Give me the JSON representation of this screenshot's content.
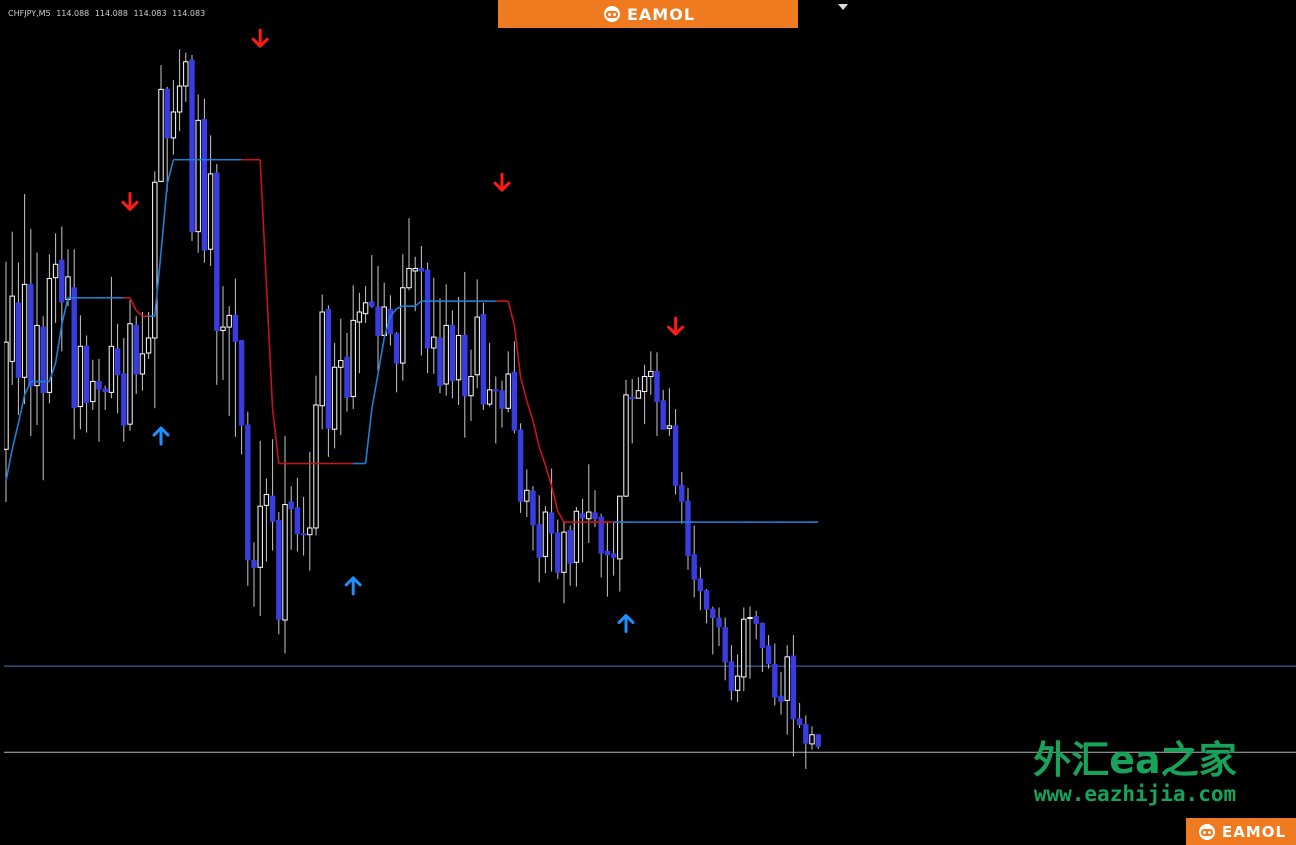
{
  "chart_header": {
    "symbol": "CHFJPY,M5",
    "ohlc": [
      "114.088",
      "114.088",
      "114.083",
      "114.083"
    ]
  },
  "branding": {
    "top_banner_text": "EAMOL",
    "bottom_banner_text": "EAMOL",
    "watermark_title": "外汇ea之家",
    "watermark_url": "www.eazhijia.com"
  },
  "colors": {
    "background": "#000000",
    "bull_candle": "#ffffff",
    "bear_candle": "#3a3ce0",
    "wick": "#c8c8c8",
    "trail_up": "#1e7fd6",
    "trail_down": "#c8141e",
    "arrow_up": "#1e90ff",
    "arrow_down": "#ff1a1a",
    "level_blue": "#3a78c8",
    "level_gray": "#b4b4b4",
    "banner": "#f07a1f",
    "watermark": "#17a35a"
  },
  "chart_data": {
    "type": "candlestick",
    "ylim": [
      0,
      100
    ],
    "horizontal_levels": [
      {
        "value": 20.9,
        "color": "level_blue"
      },
      {
        "value": 10.6,
        "color": "level_gray"
      }
    ],
    "candles": [
      [
        46.8,
        59.6,
        69.2,
        40.5
      ],
      [
        57.3,
        65.1,
        72.8,
        54.5
      ],
      [
        64.3,
        55.4,
        69.1,
        50.9
      ],
      [
        55.4,
        66.5,
        77.3,
        52.2
      ],
      [
        66.5,
        54.4,
        73.1,
        48.4
      ],
      [
        54.4,
        61.6,
        70.3,
        49.7
      ],
      [
        61.4,
        53.6,
        62.7,
        43.1
      ],
      [
        53.6,
        67.2,
        70.1,
        52.3
      ],
      [
        67.3,
        68.9,
        72.6,
        61.9
      ],
      [
        69.4,
        64.4,
        73.4,
        58.5
      ],
      [
        64.7,
        67.4,
        70.7,
        63.9
      ],
      [
        66.1,
        51.8,
        70.7,
        48.0
      ],
      [
        51.9,
        59.1,
        62.8,
        49.2
      ],
      [
        59.1,
        52.4,
        60.4,
        48.8
      ],
      [
        52.5,
        54.9,
        57.5,
        51.5
      ],
      [
        54.9,
        54.0,
        57.6,
        47.7
      ],
      [
        54.0,
        53.7,
        54.4,
        51.5
      ],
      [
        53.6,
        59.1,
        67.4,
        52.9
      ],
      [
        58.8,
        55.7,
        61.8,
        51.1
      ],
      [
        55.8,
        49.7,
        60.1,
        47.7
      ],
      [
        49.8,
        61.8,
        64.6,
        49.0
      ],
      [
        61.6,
        55.8,
        62.7,
        53.4
      ],
      [
        55.8,
        58.2,
        63.2,
        53.8
      ],
      [
        58.3,
        60.1,
        63.2,
        57.6
      ],
      [
        60.1,
        78.7,
        80.0,
        51.7
      ],
      [
        78.8,
        89.8,
        92.7,
        78.7
      ],
      [
        89.8,
        84.0,
        90.1,
        77.6
      ],
      [
        84.0,
        87.1,
        90.9,
        82.0
      ],
      [
        87.1,
        90.2,
        94.6,
        84.8
      ],
      [
        90.2,
        93.1,
        94.2,
        88.3
      ],
      [
        93.3,
        72.8,
        93.9,
        71.7
      ],
      [
        72.8,
        86.1,
        89.2,
        70.3
      ],
      [
        86.2,
        70.6,
        88.7,
        69.1
      ],
      [
        70.7,
        79.7,
        84.3,
        68.7
      ],
      [
        79.8,
        61.0,
        80.9,
        54.5
      ],
      [
        61.0,
        61.4,
        66.3,
        55.1
      ],
      [
        61.4,
        62.8,
        63.9,
        50.8
      ],
      [
        62.8,
        59.7,
        67.2,
        48.3
      ],
      [
        59.8,
        49.7,
        59.6,
        46.2
      ],
      [
        49.7,
        33.6,
        51.3,
        30.5
      ],
      [
        33.5,
        32.7,
        35.7,
        28.0
      ],
      [
        32.7,
        40.0,
        47.8,
        26.9
      ],
      [
        40.1,
        41.4,
        43.3,
        33.4
      ],
      [
        41.2,
        38.2,
        48.0,
        34.7
      ],
      [
        38.3,
        26.5,
        39.3,
        24.7
      ],
      [
        26.4,
        40.2,
        48.4,
        22.4
      ],
      [
        40.5,
        39.7,
        42.4,
        34.8
      ],
      [
        39.8,
        36.7,
        43.4,
        34.6
      ],
      [
        36.7,
        36.6,
        41.1,
        34.1
      ],
      [
        36.6,
        37.4,
        46.5,
        32.3
      ],
      [
        37.4,
        52.1,
        55.6,
        36.5
      ],
      [
        52.0,
        63.2,
        65.3,
        49.2
      ],
      [
        63.5,
        49.3,
        64.0,
        45.9
      ],
      [
        49.2,
        56.6,
        59.5,
        46.9
      ],
      [
        56.6,
        57.4,
        62.4,
        48.5
      ],
      [
        57.8,
        53.0,
        60.7,
        51.3
      ],
      [
        53.1,
        62.2,
        66.4,
        51.6
      ],
      [
        62.0,
        63.2,
        65.5,
        55.9
      ],
      [
        63.0,
        64.3,
        66.3,
        61.9
      ],
      [
        64.4,
        63.9,
        70.0,
        63.7
      ],
      [
        63.8,
        60.4,
        68.7,
        56.1
      ],
      [
        60.4,
        63.8,
        66.7,
        60.5
      ],
      [
        63.5,
        60.6,
        65.2,
        59.2
      ],
      [
        60.6,
        57.1,
        60.8,
        53.6
      ],
      [
        57.1,
        66.1,
        70.1,
        55.0
      ],
      [
        66.1,
        68.4,
        74.4,
        65.8
      ],
      [
        68.1,
        68.4,
        69.8,
        63.3
      ],
      [
        68.4,
        68.1,
        71.1,
        58.0
      ],
      [
        68.2,
        58.9,
        69.1,
        55.9
      ],
      [
        58.9,
        60.2,
        67.3,
        55.8
      ],
      [
        60.1,
        54.4,
        64.8,
        53.5
      ],
      [
        54.6,
        61.6,
        66.5,
        53.2
      ],
      [
        61.6,
        55.0,
        63.4,
        52.9
      ],
      [
        55.1,
        60.4,
        65.0,
        52.1
      ],
      [
        60.4,
        53.2,
        68.0,
        48.2
      ],
      [
        53.2,
        55.5,
        58.7,
        50.2
      ],
      [
        55.7,
        62.6,
        67.1,
        54.1
      ],
      [
        62.9,
        52.2,
        64.3,
        51.5
      ],
      [
        52.2,
        53.9,
        59.5,
        51.9
      ],
      [
        53.9,
        53.8,
        55.5,
        47.5
      ],
      [
        53.8,
        51.7,
        55.0,
        49.4
      ],
      [
        51.7,
        55.8,
        58.5,
        51.2
      ],
      [
        56.0,
        49.1,
        59.7,
        48.7
      ],
      [
        49.1,
        40.6,
        49.9,
        39.2
      ],
      [
        40.6,
        41.9,
        44.4,
        38.7
      ],
      [
        41.8,
        37.8,
        42.4,
        34.7
      ],
      [
        37.8,
        33.9,
        41.3,
        30.9
      ],
      [
        34.0,
        39.3,
        40.0,
        32.0
      ],
      [
        39.2,
        36.8,
        44.5,
        32.2
      ],
      [
        36.8,
        32.1,
        38.4,
        31.3
      ],
      [
        32.1,
        36.9,
        38.2,
        28.4
      ],
      [
        37.1,
        33.2,
        37.7,
        30.5
      ],
      [
        33.3,
        39.4,
        39.9,
        30.4
      ],
      [
        39.1,
        38.6,
        40.9,
        33.3
      ],
      [
        38.5,
        39.3,
        45.0,
        35.6
      ],
      [
        39.2,
        38.5,
        41.9,
        37.5
      ],
      [
        38.7,
        34.4,
        39.1,
        31.5
      ],
      [
        34.6,
        34.2,
        38.2,
        29.2
      ],
      [
        34.3,
        33.9,
        38.1,
        31.7
      ],
      [
        33.7,
        41.2,
        41.0,
        29.8
      ],
      [
        41.2,
        53.3,
        55.1,
        41.1
      ],
      [
        53.0,
        52.9,
        55.2,
        47.5
      ],
      [
        52.9,
        53.8,
        55.4,
        53.1
      ],
      [
        53.7,
        55.5,
        56.9,
        49.8
      ],
      [
        55.5,
        56.1,
        58.5,
        53.3
      ],
      [
        56.1,
        52.5,
        58.4,
        48.4
      ],
      [
        52.6,
        49.2,
        53.9,
        49.4
      ],
      [
        49.3,
        49.6,
        54.1,
        48.4
      ],
      [
        49.6,
        42.5,
        51.6,
        41.4
      ],
      [
        42.5,
        40.6,
        44.1,
        37.9
      ],
      [
        40.6,
        34.1,
        42.2,
        32.4
      ],
      [
        34.2,
        31.3,
        37.7,
        29.1
      ],
      [
        31.3,
        29.9,
        32.7,
        27.6
      ],
      [
        29.9,
        27.7,
        30.1,
        26.0
      ],
      [
        27.7,
        26.7,
        28.0,
        22.3
      ],
      [
        26.6,
        25.6,
        27.9,
        23.3
      ],
      [
        25.5,
        21.4,
        26.7,
        19.2
      ],
      [
        21.4,
        18.0,
        23.4,
        16.8
      ],
      [
        18.0,
        19.7,
        22.3,
        16.6
      ],
      [
        19.6,
        26.5,
        27.9,
        17.9
      ],
      [
        26.6,
        26.7,
        28.0,
        19.4
      ],
      [
        26.8,
        26.0,
        27.5,
        24.1
      ],
      [
        26.0,
        23.1,
        26.1,
        20.2
      ],
      [
        23.3,
        21.2,
        24.6,
        20.6
      ],
      [
        21.1,
        17.2,
        23.6,
        16.2
      ],
      [
        17.3,
        16.7,
        20.2,
        15.1
      ],
      [
        16.8,
        22.0,
        23.4,
        12.7
      ],
      [
        22.1,
        14.6,
        24.6,
        10.1
      ],
      [
        14.6,
        13.9,
        16.5,
        13.5
      ],
      [
        13.9,
        11.7,
        15.0,
        8.6
      ],
      [
        11.6,
        12.7,
        13.7,
        10.9
      ],
      [
        12.7,
        11.3,
        12.7,
        11.0
      ]
    ],
    "trail_line": [
      [
        0,
        43.0,
        "up"
      ],
      [
        1,
        46.8,
        "up"
      ],
      [
        2,
        49.9,
        "up"
      ],
      [
        3,
        53.3,
        "up"
      ],
      [
        4,
        54.9,
        "up"
      ],
      [
        5,
        54.9,
        "up"
      ],
      [
        6,
        54.9,
        "up"
      ],
      [
        7,
        54.9,
        "up"
      ],
      [
        8,
        57.1,
        "up"
      ],
      [
        9,
        61.7,
        "up"
      ],
      [
        10,
        64.9,
        "up"
      ],
      [
        11,
        64.9,
        "up"
      ],
      [
        12,
        64.9,
        "up"
      ],
      [
        13,
        64.9,
        "up"
      ],
      [
        14,
        64.9,
        "up"
      ],
      [
        15,
        64.9,
        "up"
      ],
      [
        16,
        64.9,
        "up"
      ],
      [
        17,
        64.9,
        "up"
      ],
      [
        18,
        64.9,
        "up"
      ],
      [
        19,
        64.9,
        "up"
      ],
      [
        20,
        64.9,
        "down"
      ],
      [
        21,
        63.4,
        "down"
      ],
      [
        22,
        62.7,
        "down"
      ],
      [
        23,
        62.7,
        "down"
      ],
      [
        24,
        62.7,
        "up"
      ],
      [
        25,
        70.3,
        "up"
      ],
      [
        26,
        78.5,
        "up"
      ],
      [
        27,
        81.4,
        "up"
      ],
      [
        28,
        81.4,
        "up"
      ],
      [
        29,
        81.4,
        "up"
      ],
      [
        30,
        81.4,
        "up"
      ],
      [
        31,
        81.4,
        "up"
      ],
      [
        32,
        81.4,
        "up"
      ],
      [
        33,
        81.4,
        "up"
      ],
      [
        34,
        81.4,
        "up"
      ],
      [
        35,
        81.4,
        "up"
      ],
      [
        36,
        81.4,
        "up"
      ],
      [
        37,
        81.4,
        "up"
      ],
      [
        38,
        81.4,
        "up"
      ],
      [
        39,
        81.4,
        "down"
      ],
      [
        40,
        81.4,
        "down"
      ],
      [
        41,
        81.4,
        "down"
      ],
      [
        42,
        66.5,
        "down"
      ],
      [
        43,
        51.6,
        "down"
      ],
      [
        44,
        45.1,
        "down"
      ],
      [
        45,
        45.1,
        "down"
      ],
      [
        46,
        45.1,
        "down"
      ],
      [
        47,
        45.1,
        "down"
      ],
      [
        48,
        45.1,
        "down"
      ],
      [
        49,
        45.1,
        "down"
      ],
      [
        50,
        45.1,
        "down"
      ],
      [
        51,
        45.1,
        "down"
      ],
      [
        52,
        45.1,
        "down"
      ],
      [
        53,
        45.1,
        "down"
      ],
      [
        54,
        45.1,
        "down"
      ],
      [
        55,
        45.1,
        "down"
      ],
      [
        56,
        45.1,
        "down"
      ],
      [
        57,
        45.1,
        "up"
      ],
      [
        58,
        45.1,
        "up"
      ],
      [
        59,
        51.6,
        "up"
      ],
      [
        60,
        55.8,
        "up"
      ],
      [
        61,
        60.1,
        "up"
      ],
      [
        62,
        62.7,
        "up"
      ],
      [
        63,
        63.6,
        "up"
      ],
      [
        64,
        63.9,
        "up"
      ],
      [
        65,
        63.9,
        "up"
      ],
      [
        66,
        63.9,
        "up"
      ],
      [
        67,
        64.5,
        "up"
      ],
      [
        68,
        64.5,
        "up"
      ],
      [
        69,
        64.5,
        "up"
      ],
      [
        70,
        64.5,
        "up"
      ],
      [
        71,
        64.5,
        "up"
      ],
      [
        72,
        64.5,
        "up"
      ],
      [
        73,
        64.5,
        "up"
      ],
      [
        74,
        64.5,
        "up"
      ],
      [
        75,
        64.5,
        "up"
      ],
      [
        76,
        64.5,
        "up"
      ],
      [
        77,
        64.5,
        "up"
      ],
      [
        78,
        64.5,
        "up"
      ],
      [
        79,
        64.5,
        "up"
      ],
      [
        80,
        64.5,
        "down"
      ],
      [
        81,
        64.5,
        "down"
      ],
      [
        82,
        61.6,
        "down"
      ],
      [
        83,
        55.4,
        "down"
      ],
      [
        84,
        52.6,
        "down"
      ],
      [
        85,
        50.2,
        "down"
      ],
      [
        86,
        47.1,
        "down"
      ],
      [
        87,
        44.9,
        "down"
      ],
      [
        88,
        42.4,
        "down"
      ],
      [
        89,
        39.4,
        "down"
      ],
      [
        90,
        38.1,
        "down"
      ],
      [
        91,
        38.1,
        "down"
      ],
      [
        92,
        38.1,
        "down"
      ],
      [
        93,
        38.1,
        "down"
      ],
      [
        94,
        38.1,
        "down"
      ],
      [
        95,
        38.1,
        "down"
      ],
      [
        96,
        38.1,
        "down"
      ],
      [
        97,
        38.1,
        "down"
      ],
      [
        98,
        38.1,
        "down"
      ],
      [
        99,
        38.1,
        "up"
      ],
      [
        100,
        38.1,
        "up"
      ],
      [
        101,
        38.1,
        "up"
      ],
      [
        102,
        38.1,
        "up"
      ],
      [
        103,
        38.1,
        "up"
      ],
      [
        104,
        38.1,
        "up"
      ],
      [
        105,
        38.1,
        "up"
      ],
      [
        106,
        38.1,
        "up"
      ],
      [
        107,
        38.1,
        "up"
      ],
      [
        108,
        38.1,
        "up"
      ],
      [
        109,
        38.1,
        "up"
      ],
      [
        110,
        38.1,
        "up"
      ],
      [
        111,
        38.1,
        "up"
      ],
      [
        112,
        38.1,
        "up"
      ],
      [
        113,
        38.1,
        "up"
      ],
      [
        114,
        38.1,
        "up"
      ],
      [
        115,
        38.1,
        "up"
      ],
      [
        116,
        38.1,
        "up"
      ],
      [
        117,
        38.1,
        "up"
      ],
      [
        118,
        38.1,
        "up"
      ],
      [
        119,
        38.1,
        "up"
      ],
      [
        120,
        38.1,
        "up"
      ],
      [
        121,
        38.1,
        "up"
      ],
      [
        122,
        38.1,
        "up"
      ],
      [
        123,
        38.1,
        "up"
      ],
      [
        124,
        38.1,
        "up"
      ],
      [
        125,
        38.1,
        "up"
      ],
      [
        126,
        38.1,
        "up"
      ],
      [
        127,
        38.1,
        "up"
      ],
      [
        128,
        38.1,
        "up"
      ],
      [
        129,
        38.1,
        "up"
      ],
      [
        130,
        38.1,
        "up"
      ],
      [
        131,
        38.1,
        "up"
      ],
      [
        132,
        38.1,
        "up"
      ],
      [
        133,
        38.1,
        "up"
      ]
    ],
    "arrows": [
      {
        "index": 25,
        "direction": "up",
        "value": 48.5
      },
      {
        "index": 20,
        "direction": "down",
        "value": 76.3
      },
      {
        "index": 41,
        "direction": "down",
        "value": 95.8
      },
      {
        "index": 56,
        "direction": "up",
        "value": 30.6
      },
      {
        "index": 80,
        "direction": "down",
        "value": 78.6
      },
      {
        "index": 100,
        "direction": "up",
        "value": 26.1
      },
      {
        "index": 108,
        "direction": "down",
        "value": 61.4
      }
    ]
  }
}
